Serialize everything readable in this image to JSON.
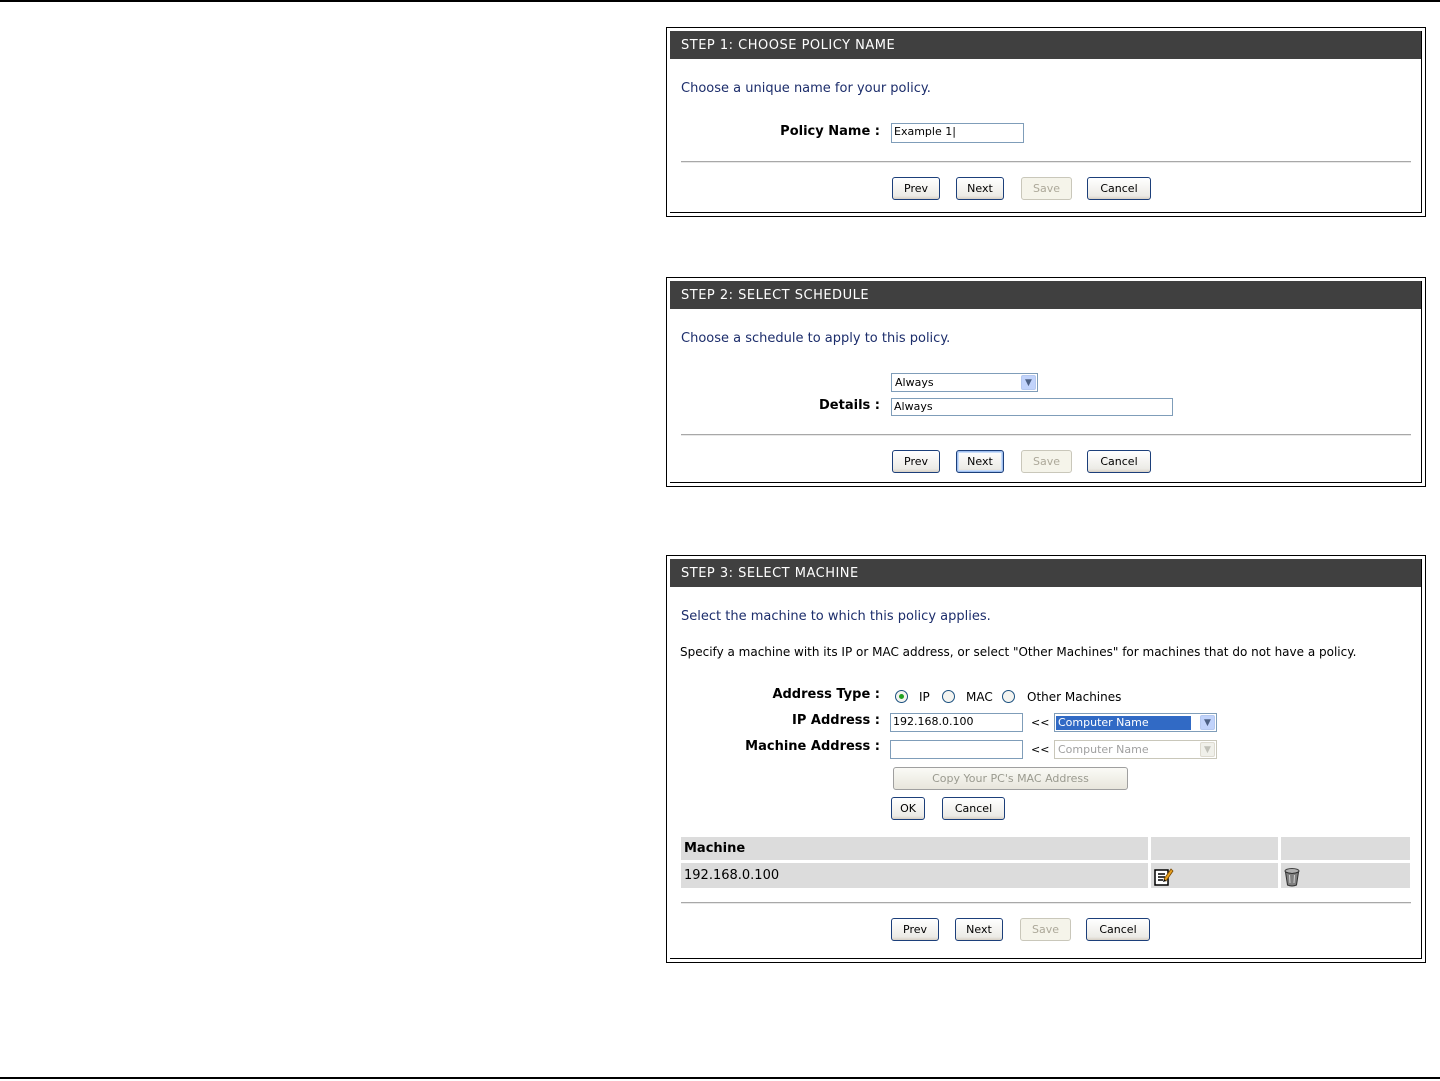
{
  "step1": {
    "title": "STEP 1: CHOOSE POLICY NAME",
    "intro": "Choose a unique name for your policy.",
    "policy_name_label": "Policy Name :",
    "policy_name_value": "Example 1|",
    "buttons": {
      "prev": "Prev",
      "next": "Next",
      "save": "Save",
      "cancel": "Cancel"
    }
  },
  "step2": {
    "title": "STEP 2: SELECT SCHEDULE",
    "intro": "Choose a schedule to apply to this policy.",
    "schedule_selected": "Always",
    "details_label": "Details :",
    "details_value": "Always",
    "buttons": {
      "prev": "Prev",
      "next": "Next",
      "save": "Save",
      "cancel": "Cancel"
    }
  },
  "step3": {
    "title": "STEP 3: SELECT MACHINE",
    "intro": "Select the machine to which this policy applies.",
    "description": "Specify a machine with its IP or MAC address, or select \"Other Machines\" for machines that do not have a policy.",
    "address_type_label": "Address Type :",
    "address_type_options": [
      "IP",
      "MAC",
      "Other Machines"
    ],
    "address_type_selected": "IP",
    "ip_address_label": "IP Address :",
    "ip_address_value": "192.168.0.100",
    "ip_separator": "<<",
    "ip_computer_select": "Computer Name",
    "machine_address_label": "Machine Address :",
    "machine_address_value": "",
    "mac_separator": "<<",
    "mac_computer_select": "Computer Name",
    "copy_mac_button": "Copy Your PC's MAC Address",
    "ok_button": "OK",
    "cancel_inline_button": "Cancel",
    "table": {
      "headers": [
        "Machine",
        "",
        ""
      ],
      "rows": [
        {
          "machine": "192.168.0.100",
          "edit_icon": "edit-icon",
          "delete_icon": "trash-icon"
        }
      ]
    },
    "buttons": {
      "prev": "Prev",
      "next": "Next",
      "save": "Save",
      "cancel": "Cancel"
    }
  },
  "colors": {
    "header_bg": "#404040",
    "intro_text": "#1c2d6b",
    "table_bg": "#dcdcdc",
    "select_highlight": "#316ac5"
  }
}
